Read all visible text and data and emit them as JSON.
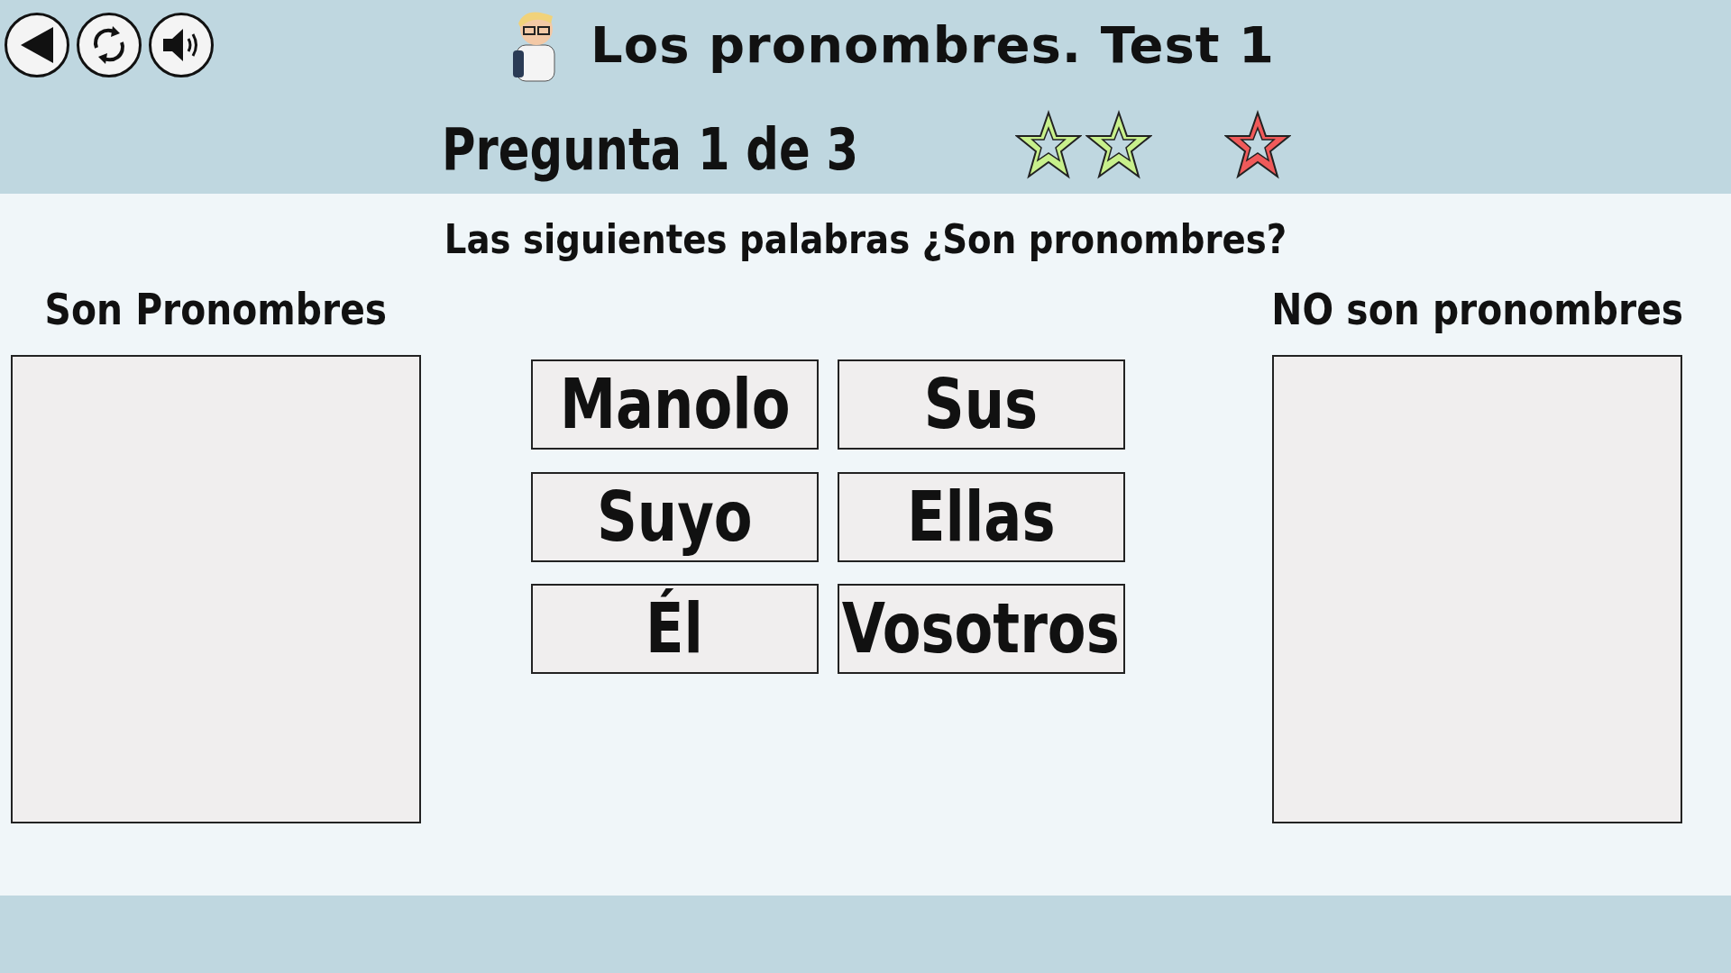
{
  "title": "Los pronombres. Test 1",
  "question_counter": "Pregunta 1 de 3",
  "stars": [
    {
      "color": "#c8f08c"
    },
    {
      "color": "#c8f08c"
    },
    {
      "color": "#f05a5a"
    }
  ],
  "question": "Las siguientes palabras ¿Son pronombres?",
  "drop_zones": [
    {
      "label": "Son Pronombres"
    },
    {
      "label": "NO son pronombres"
    }
  ],
  "words": [
    "Manolo",
    "Sus",
    "Suyo",
    "Ellas",
    "Él",
    "Vosotros"
  ]
}
